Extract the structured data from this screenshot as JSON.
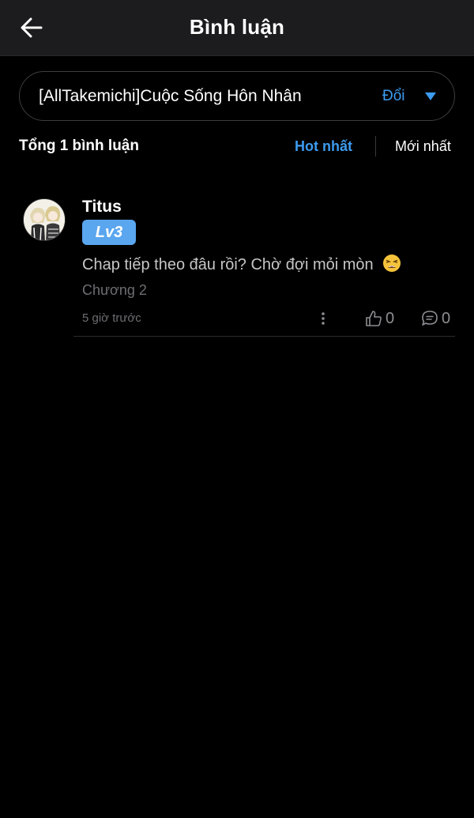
{
  "header": {
    "title": "Bình luận",
    "back_icon": "arrow-left-icon"
  },
  "story_selector": {
    "title": "[AllTakemichi]Cuộc Sống Hôn Nhân",
    "change_label": "Đổi",
    "caret_icon": "triangle-down-icon"
  },
  "summary": {
    "total_label": "Tổng 1 bình luận",
    "sort_hot": "Hot nhất",
    "sort_new": "Mới nhất",
    "active_sort": "Hot nhất"
  },
  "comments": [
    {
      "username": "Titus",
      "level": "Lv3",
      "text": "Chap tiếp theo đâu rồi? Chờ đợi mỏi mòn",
      "emoji": "tired-face-emoji",
      "chapter": "Chương 2",
      "time": "5 giờ trước",
      "likes": "0",
      "replies": "0"
    }
  ],
  "colors": {
    "background": "#000000",
    "header_bg": "#1c1c1e",
    "accent": "#3d9bf0",
    "level_badge": "#5aa6ef",
    "muted_text": "#6e6e73"
  }
}
